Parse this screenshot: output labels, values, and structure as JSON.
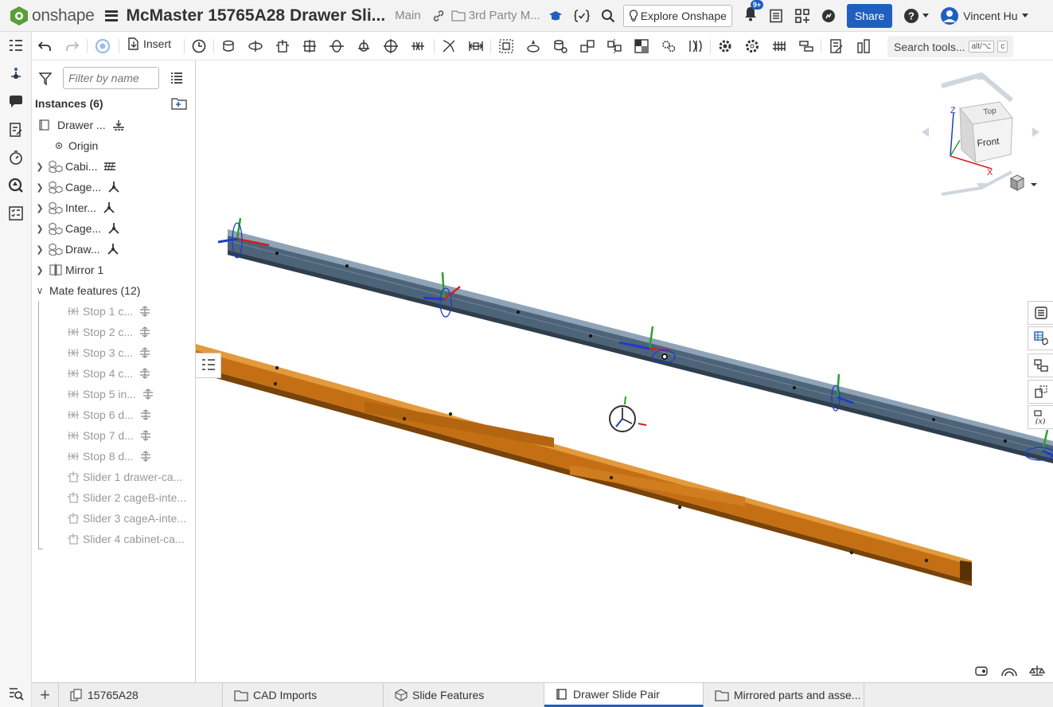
{
  "app": {
    "name": "onshape",
    "brand_color": "#5a9e3a",
    "accent": "#1f5fbf"
  },
  "header": {
    "document_title": "McMaster 15765A28 Drawer Sli...",
    "branch": "Main",
    "folder": "3rd Party M...",
    "explore_label": "Explore Onshape",
    "notification_count": "9+",
    "share_label": "Share",
    "user_name": "Vincent Hu"
  },
  "toolbar": {
    "insert_label": "Insert",
    "search_label": "Search tools...",
    "search_shortcut_1": "alt/⌥",
    "search_shortcut_2": "c"
  },
  "panel": {
    "filter_placeholder": "Filter by name",
    "instances_header": "Instances (6)",
    "instances": [
      {
        "label": "Drawer ...",
        "suffix_icon": "fixed-icon"
      },
      {
        "label": "Origin"
      },
      {
        "label": "Cabi...",
        "suffix_icon": "group-fixed-icon"
      },
      {
        "label": "Cage...",
        "suffix_icon": "mate-connector-icon"
      },
      {
        "label": "Inter...",
        "suffix_icon": "mate-connector-icon"
      },
      {
        "label": "Cage...",
        "suffix_icon": "mate-connector-icon"
      },
      {
        "label": "Draw...",
        "suffix_icon": "mate-connector-icon"
      },
      {
        "label": "Mirror 1"
      }
    ],
    "mates_header": "Mate features (12)",
    "mates": [
      {
        "label": "Stop 1 c..."
      },
      {
        "label": "Stop 2 c..."
      },
      {
        "label": "Stop 3 c..."
      },
      {
        "label": "Stop 4 c..."
      },
      {
        "label": "Stop 5 in..."
      },
      {
        "label": "Stop 6 d..."
      },
      {
        "label": "Stop 7 d..."
      },
      {
        "label": "Stop 8 d..."
      },
      {
        "label": "Slider 1 drawer-ca..."
      },
      {
        "label": "Slider 2 cageB-inte..."
      },
      {
        "label": "Slider 3 cageA-inte..."
      },
      {
        "label": "Slider 4 cabinet-ca..."
      }
    ]
  },
  "viewcube": {
    "top": "Top",
    "front": "Front",
    "axis_x": "X",
    "axis_z": "Z"
  },
  "tabs": [
    {
      "label": "15765A28",
      "icon": "document-icon"
    },
    {
      "label": "CAD Imports",
      "icon": "folder-icon"
    },
    {
      "label": "Slide Features",
      "icon": "part-studio-icon"
    },
    {
      "label": "Drawer Slide Pair",
      "icon": "assembly-icon",
      "active": true
    },
    {
      "label": "Mirrored parts and asse...",
      "icon": "folder-icon"
    }
  ],
  "colors": {
    "rail_steel": "#4d6377",
    "rail_steel_light": "#8ea3b6",
    "rail_orange": "#c56f14",
    "rail_orange_light": "#e39a3d"
  }
}
